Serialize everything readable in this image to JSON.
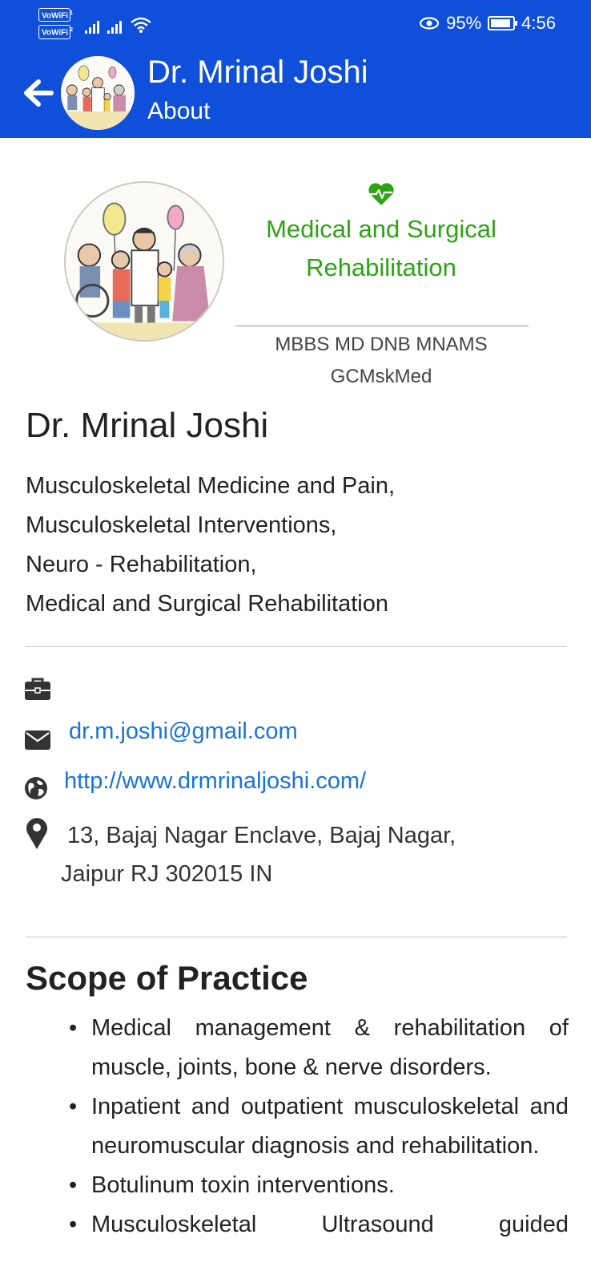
{
  "status_bar": {
    "vowifi_1": "VoWiFi",
    "vowifi_1_sub": "1",
    "vowifi_2": "VoWiFi",
    "vowifi_2_sub": "2",
    "battery_percent": "95%",
    "time": "4:56"
  },
  "app_bar": {
    "title": "Dr. Mrinal Joshi",
    "subtitle": "About"
  },
  "profile": {
    "tagline_line1": "Medical and Surgical",
    "tagline_line2": "Rehabilitation",
    "degrees_line1": "MBBS MD DNB MNAMS",
    "degrees_line2": "GCMskMed",
    "name": "Dr. Mrinal Joshi",
    "specialties": [
      "Musculoskeletal Medicine and Pain,",
      "Musculoskeletal Interventions,",
      "Neuro - Rehabilitation,",
      "Medical and Surgical Rehabilitation"
    ]
  },
  "contact": {
    "email": "dr.m.joshi@gmail.com",
    "website": "http://www.drmrinaljoshi.com/",
    "address_line1": "13, Bajaj Nagar Enclave, Bajaj Nagar,",
    "address_line2": "Jaipur RJ 302015 IN"
  },
  "scope": {
    "title": "Scope of Practice",
    "items": [
      "Medical management & rehabilitation of muscle, joints, bone & nerve disorders.",
      "Inpatient and outpatient musculoskeletal and neuromuscular diagnosis and rehabilitation.",
      "Botulinum toxin interventions.",
      "Musculoskeletal Ultrasound guided"
    ]
  },
  "colors": {
    "primary": "#0f4fd9",
    "tagline_green": "#2ea313",
    "link_blue": "#1a73d8"
  },
  "icons": [
    "back-arrow-icon",
    "heart-pulse-icon",
    "briefcase-icon",
    "envelope-icon",
    "globe-icon",
    "map-pin-icon",
    "eye-icon",
    "battery-icon",
    "wifi-icon",
    "signal-icon"
  ]
}
